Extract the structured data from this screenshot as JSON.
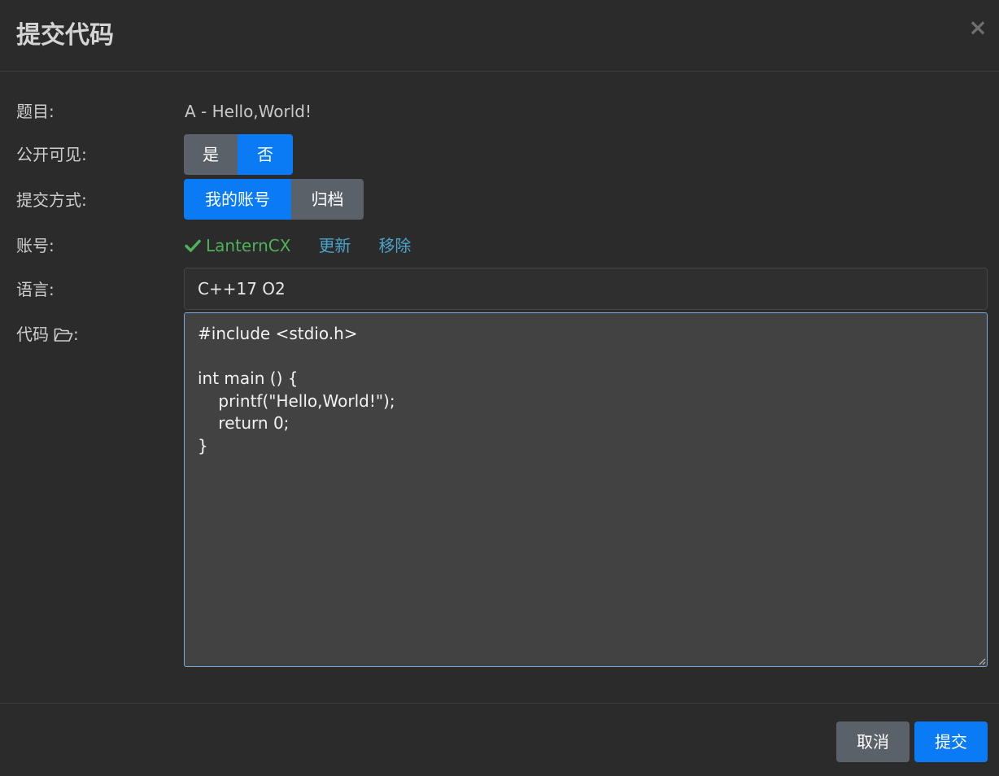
{
  "modal": {
    "title": "提交代码",
    "close_label": "×"
  },
  "form": {
    "problem": {
      "label": "题目:",
      "value": "A - Hello,World!"
    },
    "visibility": {
      "label": "公开可见:",
      "options": [
        "是",
        "否"
      ],
      "selected": "否"
    },
    "method": {
      "label": "提交方式:",
      "options": [
        "我的账号",
        "归档"
      ],
      "selected": "我的账号"
    },
    "account": {
      "label": "账号:",
      "username": "LanternCX",
      "update_label": "更新",
      "remove_label": "移除"
    },
    "language": {
      "label": "语言:",
      "value": "C++17 O2"
    },
    "code": {
      "label": "代码",
      "value": "#include <stdio.h>\n\nint main () {\n    printf(\"Hello,World!\");\n    return 0;\n}"
    }
  },
  "footer": {
    "cancel_label": "取消",
    "submit_label": "提交"
  },
  "colors": {
    "accent": "#0a7bf5",
    "secondary": "#5b6169",
    "success": "#4fb15a",
    "link": "#4aa3c9",
    "background": "#2b2b2b"
  },
  "icons": [
    "close-icon",
    "check-icon",
    "folder-open-icon",
    "resize-grip-icon"
  ]
}
